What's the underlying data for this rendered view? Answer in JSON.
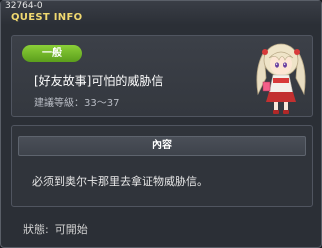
{
  "window": {
    "quest_id": "32764-0",
    "title": "QUEST INFO"
  },
  "quest": {
    "category": "一般",
    "title": "[好友故事]可怕的威胁信",
    "level": "建議等級：33～37"
  },
  "content": {
    "header": "內容",
    "text": "必须到奥尔卡那里去拿证物威胁信。"
  },
  "status": {
    "label": "狀態:",
    "value": "可開始"
  },
  "colors": {
    "badge": "#6fb82a",
    "title_accent": "#f0d870",
    "background": "#2b2f36"
  },
  "icons": {
    "npc": "npc-portrait-girl"
  }
}
